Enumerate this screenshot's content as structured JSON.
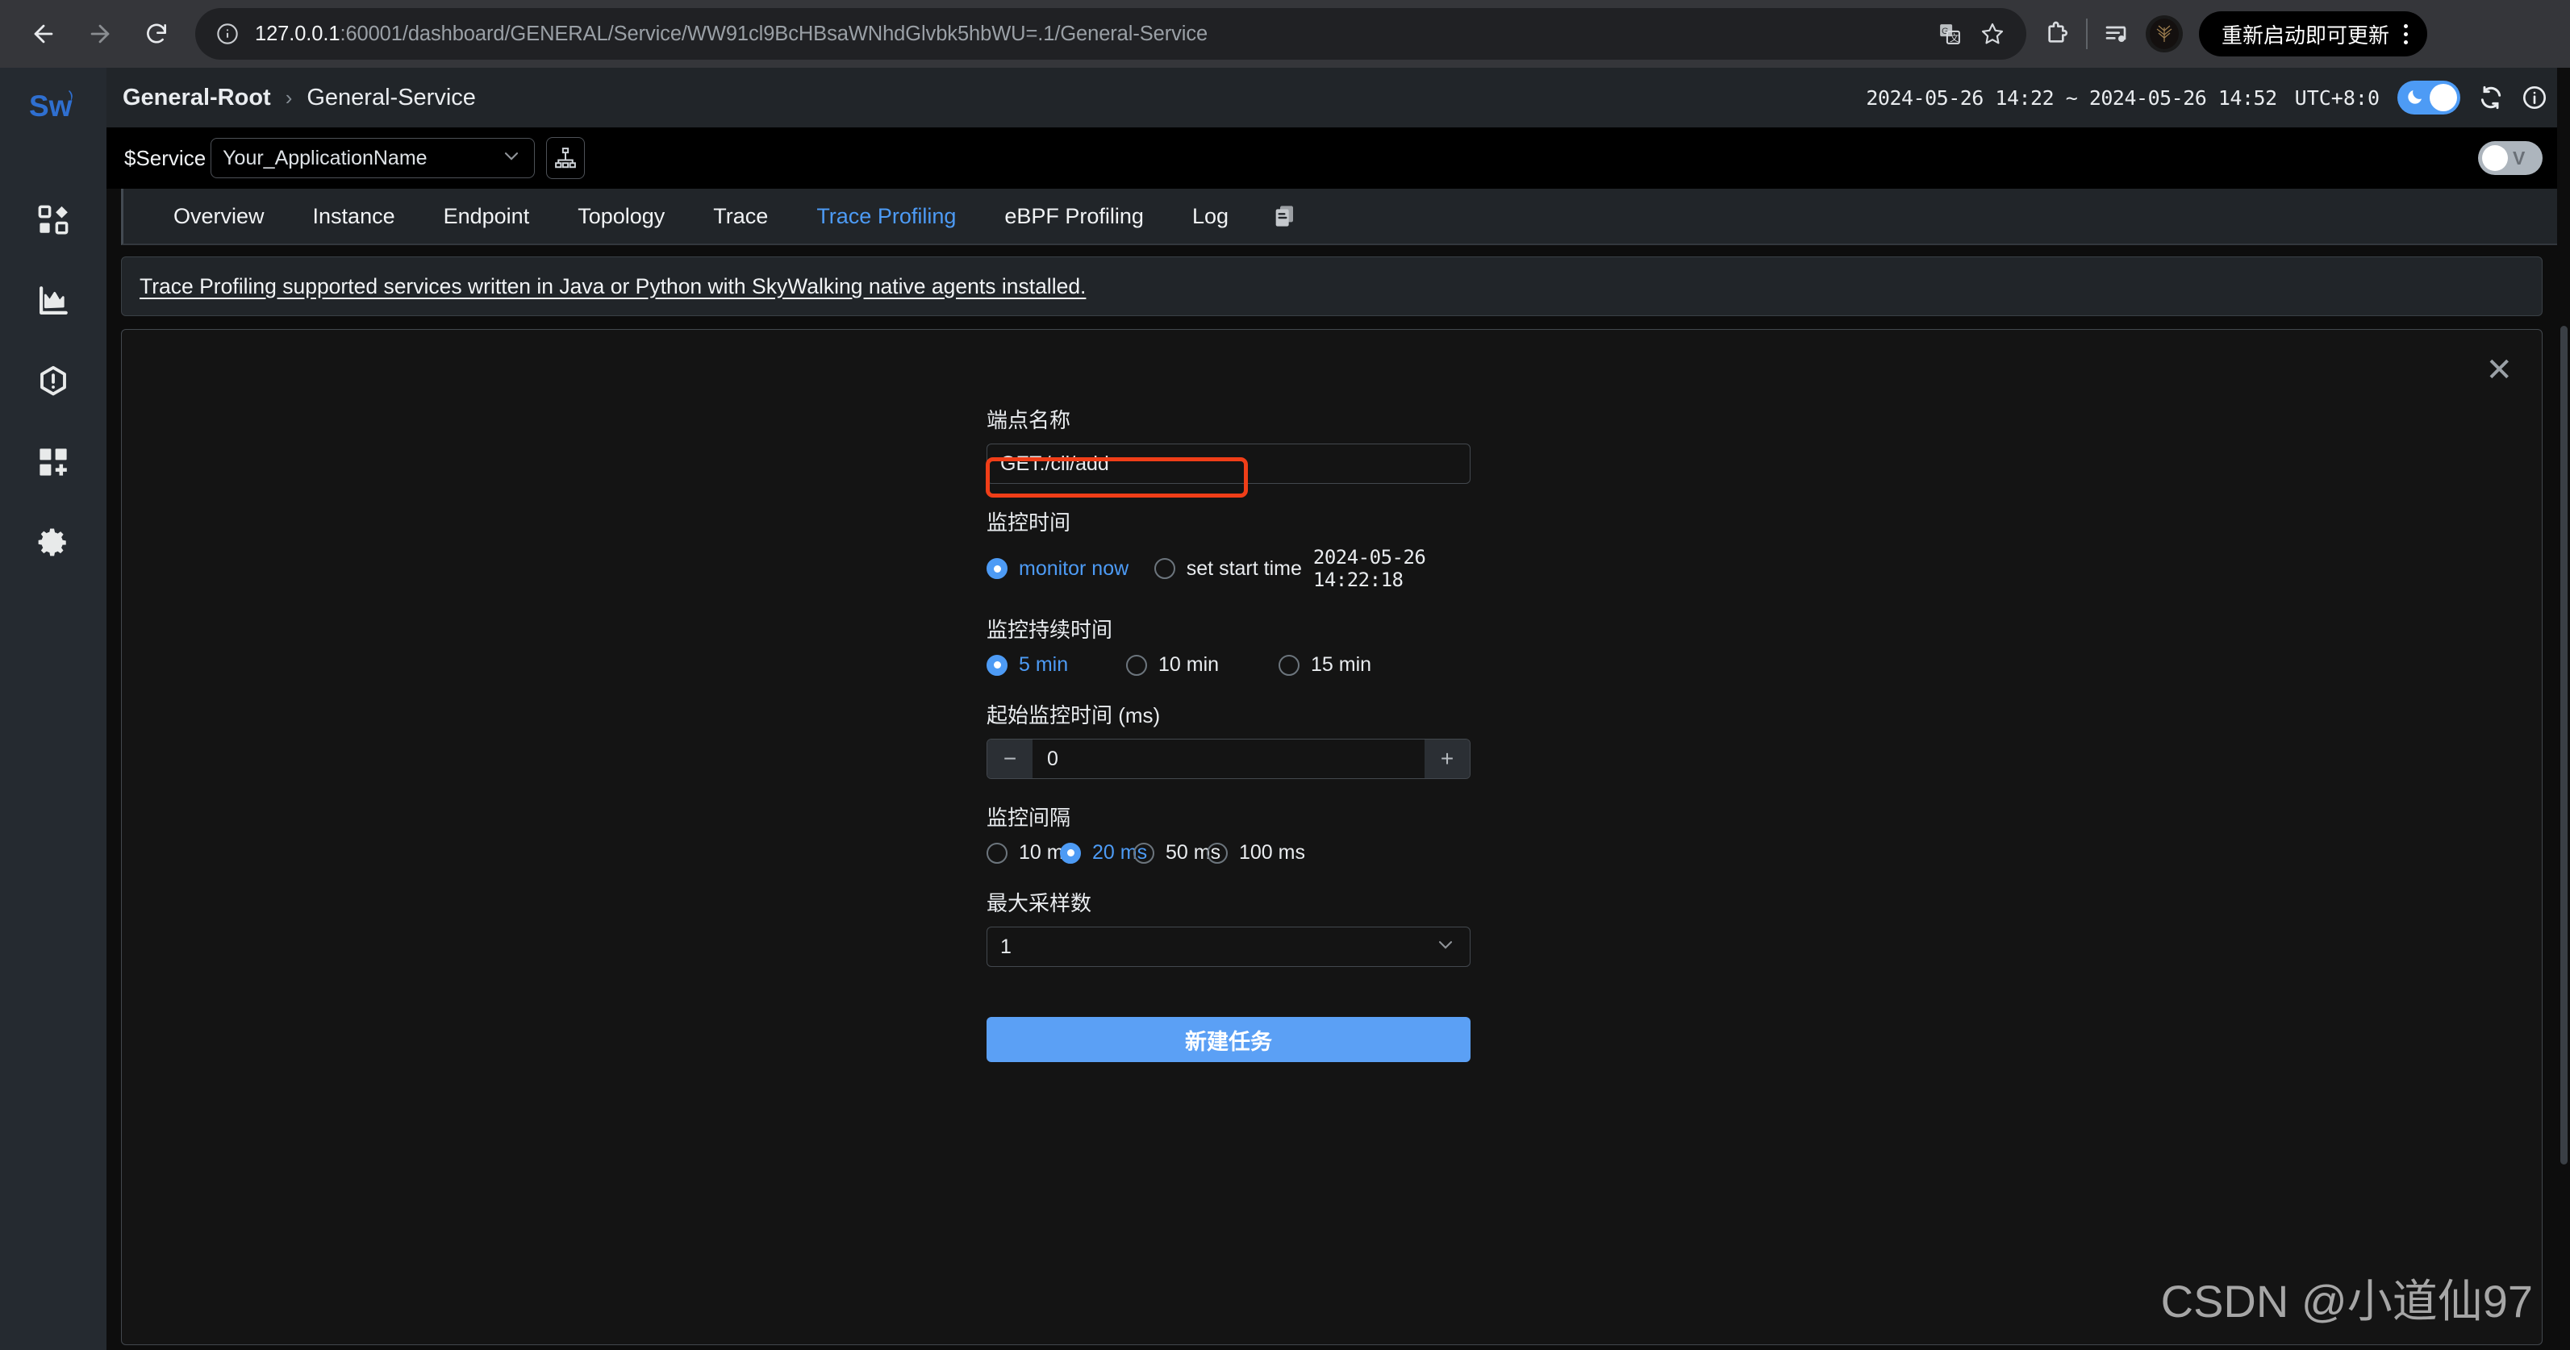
{
  "browser": {
    "back_icon": "arrow-left-icon",
    "forward_icon": "arrow-right-icon",
    "reload_icon": "reload-icon",
    "info_icon": "site-info-icon",
    "url_host": "127.0.0.1",
    "url_rest": ":60001/dashboard/GENERAL/Service/WW91cl9BcHBsaWNhdGlvbk5hbWU=.1/General-Service",
    "translate_icon": "translate-icon",
    "bookmark_icon": "star-icon",
    "extensions_icon": "extensions-icon",
    "reading_list_icon": "reading-list-icon",
    "profile_icon": "profile-avatar-icon",
    "update_label": "重新启动即可更新",
    "menu_icon": "kebab-menu-icon"
  },
  "sidebar": {
    "logo": "skywalking-logo",
    "items": [
      {
        "name": "dashboard",
        "icon": "dashboard-blocks-icon"
      },
      {
        "name": "metrics",
        "icon": "chart-area-icon"
      },
      {
        "name": "alerts",
        "icon": "alert-hexagon-icon"
      },
      {
        "name": "marketplace",
        "icon": "add-widget-icon"
      },
      {
        "name": "settings",
        "icon": "gear-icon"
      }
    ]
  },
  "header": {
    "breadcrumb_root": "General-Root",
    "breadcrumb_separator": "›",
    "breadcrumb_current": "General-Service",
    "time_range": "2024-05-26 14:22 ~ 2024-05-26 14:52",
    "timezone": "UTC+8:0",
    "dark_toggle_icon": "moon-icon",
    "refresh_icon": "refresh-icon",
    "info_icon": "info-circle-icon"
  },
  "selector_bar": {
    "label": "$Service",
    "value": "Your_ApplicationName",
    "chevron_icon": "chevron-down-icon",
    "topology_icon": "topology-tree-icon",
    "view_toggle_label": "V"
  },
  "tabs": {
    "items": [
      {
        "label": "Overview",
        "active": false
      },
      {
        "label": "Instance",
        "active": false
      },
      {
        "label": "Endpoint",
        "active": false
      },
      {
        "label": "Topology",
        "active": false
      },
      {
        "label": "Trace",
        "active": false
      },
      {
        "label": "Trace Profiling",
        "active": true
      },
      {
        "label": "eBPF Profiling",
        "active": false
      },
      {
        "label": "Log",
        "active": false
      }
    ],
    "copy_icon": "copy-pages-icon"
  },
  "banner": {
    "text": "Trace Profiling supported services written in Java or Python with SkyWalking native agents installed."
  },
  "panel": {
    "close_icon": "close-icon"
  },
  "form": {
    "endpoint": {
      "label": "端点名称",
      "value": "GET:/cli/add"
    },
    "monitor_time": {
      "label": "监控时间",
      "options": [
        {
          "label": "monitor now",
          "selected": true
        },
        {
          "label": "set start time",
          "selected": false
        }
      ],
      "start_time_value": "2024-05-26 14:22:18"
    },
    "duration": {
      "label": "监控持续时间",
      "options": [
        {
          "label": "5 min",
          "selected": true
        },
        {
          "label": "10 min",
          "selected": false
        },
        {
          "label": "15 min",
          "selected": false
        }
      ]
    },
    "min_duration": {
      "label": "起始监控时间 (ms)",
      "value": "0",
      "minus_icon": "minus-icon",
      "plus_icon": "plus-icon"
    },
    "interval": {
      "label": "监控间隔",
      "options": [
        {
          "label": "10 ms",
          "selected": false
        },
        {
          "label": "20 ms",
          "selected": true
        },
        {
          "label": "50 ms",
          "selected": false
        },
        {
          "label": "100 ms",
          "selected": false
        }
      ]
    },
    "max_samples": {
      "label": "最大采样数",
      "value": "1",
      "chevron_icon": "chevron-down-icon"
    },
    "submit_label": "新建任务"
  },
  "watermark": "CSDN @小道仙97",
  "colors": {
    "accent_blue": "#4d9bf5",
    "button_blue": "#5ba0f5",
    "annotation_red": "#f03e18",
    "sidebar_bg": "#252a30",
    "panel_bg": "#141414",
    "page_bg": "#0d0d0d"
  }
}
